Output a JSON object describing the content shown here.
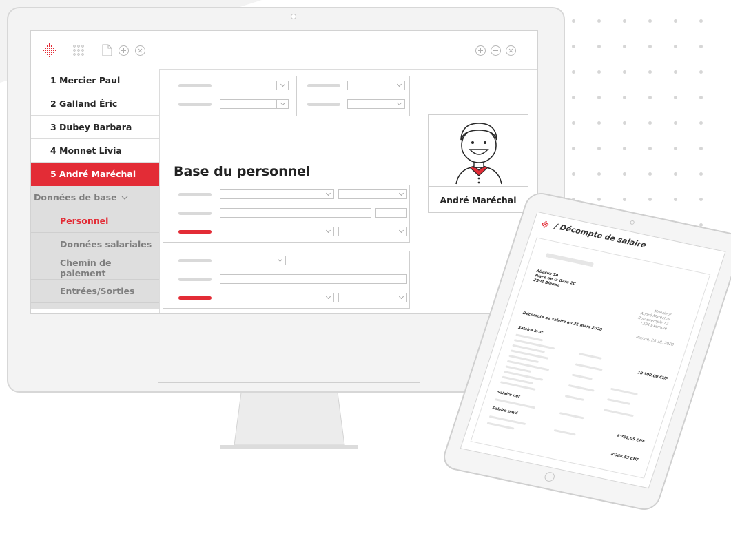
{
  "people": [
    {
      "label": "1 Mercier Paul"
    },
    {
      "label": "2 Galland Éric"
    },
    {
      "label": "3 Dubey Barbara"
    },
    {
      "label": "4 Monnet Livia"
    },
    {
      "label": "5 André Maréchal"
    }
  ],
  "sidebar": {
    "section_label": "Données de base",
    "items": [
      {
        "label": "Personnel"
      },
      {
        "label": "Données salariales"
      },
      {
        "label": "Chemin de paiement"
      },
      {
        "label": "Entrées/Sorties"
      }
    ]
  },
  "main": {
    "title": "Base du personnel",
    "employee_name": "André Maréchal"
  },
  "tablet": {
    "title": "Décompte de salaire",
    "company": "Abacus SA\nPlace de la Gare 2C\n2501 Bienne",
    "recipient": "Monsieur\nAndré Maréchal\nRue exemple 12\n1234 Exemple",
    "statement_title": "Décompte de salaire au 31 mars 2020",
    "place_date": "Bienne, 28.10. 2020",
    "gross_label": "Salaire brut",
    "gross_value": "10'300.00 CHF",
    "net_label": "Salaire net",
    "net_value": "8'702.05 CHF",
    "paid_label": "Salaire payé",
    "paid_value": "8'368.55 CHF"
  },
  "colors": {
    "accent": "#e32c36",
    "sidebar_sub_bg": "#dedede",
    "border": "#cfcfcf"
  },
  "icons": [
    "logo-icon",
    "apps-grid-icon",
    "new-document-icon",
    "add-icon",
    "close-icon",
    "window-add-icon",
    "window-minimize-icon",
    "window-close-icon"
  ]
}
